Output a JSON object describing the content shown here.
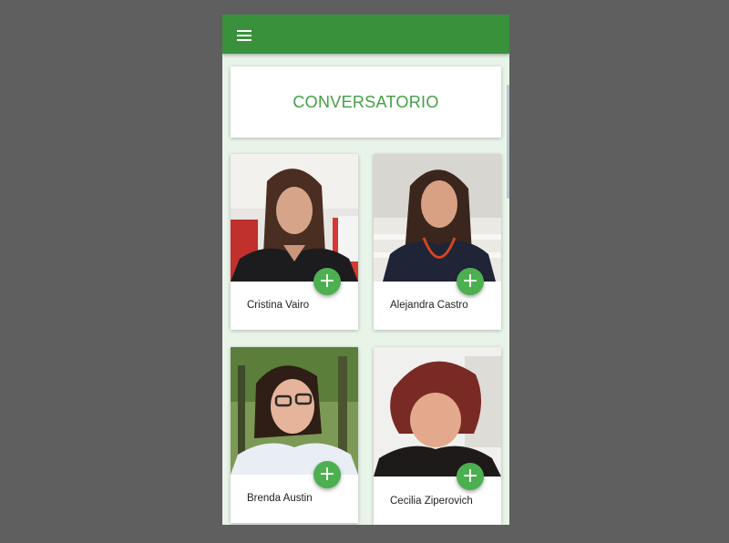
{
  "app": {
    "menu_icon": "hamburger-menu-icon",
    "accent_color": "#3a913c",
    "title_color": "#43a047",
    "fab_color": "#4caf50"
  },
  "title_card": {
    "title": "CONVERSATORIO"
  },
  "speakers": [
    {
      "name": "Cristina Vairo",
      "action_icon": "plus-icon",
      "action_label": "+"
    },
    {
      "name": "Alejandra Castro",
      "action_icon": "plus-icon",
      "action_label": "+"
    },
    {
      "name": "Brenda Austin",
      "action_icon": "plus-icon",
      "action_label": "+"
    },
    {
      "name": "Cecilia Ziperovich",
      "action_icon": "plus-icon",
      "action_label": "+"
    }
  ]
}
